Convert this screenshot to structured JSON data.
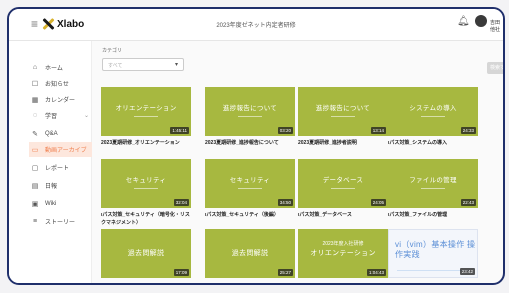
{
  "app": {
    "logo_text": "Xlabo",
    "window_title": "2023年度ゼネット内定者研修",
    "user_name": "吉田他社"
  },
  "sidebar": {
    "items": [
      {
        "icon": "home-icon",
        "glyph": "⌂",
        "label": "ホーム"
      },
      {
        "icon": "notice-icon",
        "glyph": "☐",
        "label": "お知らせ"
      },
      {
        "icon": "calendar-icon",
        "glyph": "▦",
        "label": "カレンダー"
      },
      {
        "icon": "study-icon",
        "glyph": "◌",
        "label": "学習"
      },
      {
        "icon": "qa-icon",
        "glyph": "✎",
        "label": "Q&A"
      },
      {
        "icon": "archive-icon",
        "glyph": "▭",
        "label": "動画アーカイブ"
      },
      {
        "icon": "report-icon",
        "glyph": "▢",
        "label": "レポート"
      },
      {
        "icon": "daily-report-icon",
        "glyph": "▤",
        "label": "日報"
      },
      {
        "icon": "wiki-icon",
        "glyph": "▣",
        "label": "Wiki"
      },
      {
        "icon": "story-icon",
        "glyph": "≡",
        "label": "ストーリー"
      }
    ]
  },
  "filter": {
    "category_label": "カテゴリ",
    "category_placeholder": "すべて",
    "search_button": "検索する"
  },
  "videos": [
    {
      "thumb_text": "オリエンテーション",
      "caption": "2023夏期研修_オリエンテーション",
      "duration": "1:45:11",
      "style": "green"
    },
    {
      "thumb_text": "進捗報告について",
      "caption": "2023夏期研修_進捗報告について",
      "duration": "03:20",
      "style": "green"
    },
    {
      "thumb_text": "進捗報告について",
      "caption": "2023夏期研修_進捗者説明",
      "duration": "13:14",
      "style": "green"
    },
    {
      "thumb_text": "システムの導入",
      "caption": "ιパス対策_システムの導入",
      "duration": "24:33",
      "style": "green"
    },
    {
      "thumb_text": "セキュリティ",
      "caption": "ιパス対策_セキュリティ（暗号化・リスクマネジメント）",
      "duration": "32:04",
      "style": "green"
    },
    {
      "thumb_text": "セキュリティ",
      "caption": "ιパス対策_セキュリティ（後編）",
      "duration": "34:50",
      "style": "green"
    },
    {
      "thumb_text": "データベース",
      "caption": "ιパス対策_データベース",
      "duration": "24:05",
      "style": "green"
    },
    {
      "thumb_text": "ファイルの管理",
      "caption": "ιパス対策_ファイルの管理",
      "duration": "22:43",
      "style": "green"
    },
    {
      "thumb_text": "過去問解説",
      "caption": "",
      "duration": "17:09",
      "style": "green"
    },
    {
      "thumb_text": "過去問解説",
      "caption": "",
      "duration": "25:27",
      "style": "green"
    },
    {
      "thumb_small": "2023年度入社研修",
      "thumb_text": "オリエンテーション",
      "caption": "",
      "duration": "1:04:43",
      "style": "green-big"
    },
    {
      "thumb_text": "vi（vim）基本操作 操作実践",
      "caption": "",
      "duration": "23:42",
      "style": "blue"
    }
  ]
}
